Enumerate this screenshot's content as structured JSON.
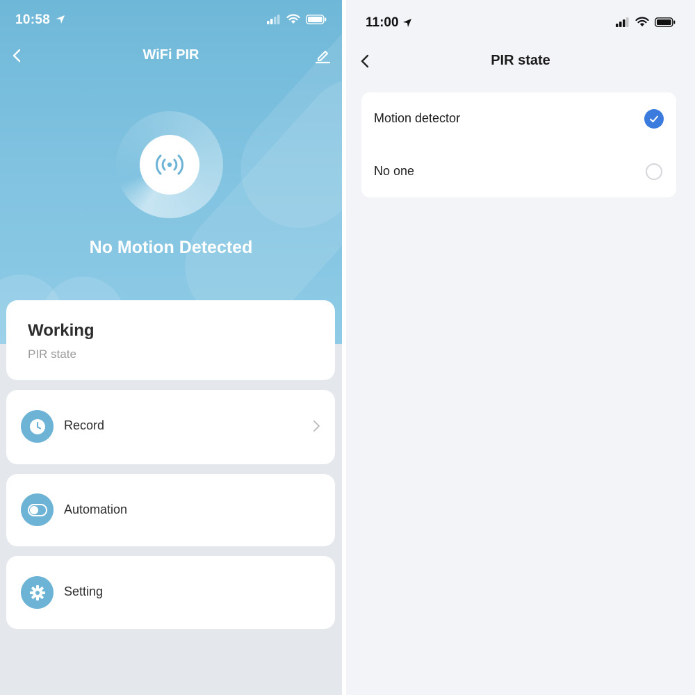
{
  "left": {
    "status_time": "10:58",
    "title": "WiFi PIR",
    "hero_status": "No Motion Detected",
    "state_card": {
      "value": "Working",
      "label": "PIR state"
    },
    "rows": [
      {
        "label": "Record",
        "icon": "clock-icon"
      },
      {
        "label": "Automation",
        "icon": "toggle-icon"
      },
      {
        "label": "Setting",
        "icon": "gear-icon"
      }
    ]
  },
  "right": {
    "status_time": "11:00",
    "title": "PIR state",
    "options": [
      {
        "label": "Motion detector",
        "selected": true
      },
      {
        "label": "No one",
        "selected": false
      }
    ]
  },
  "colors": {
    "hero_blue": "#7fc2e0",
    "icon_blue": "#6db3d6",
    "accent_blue": "#3a7bdd"
  }
}
